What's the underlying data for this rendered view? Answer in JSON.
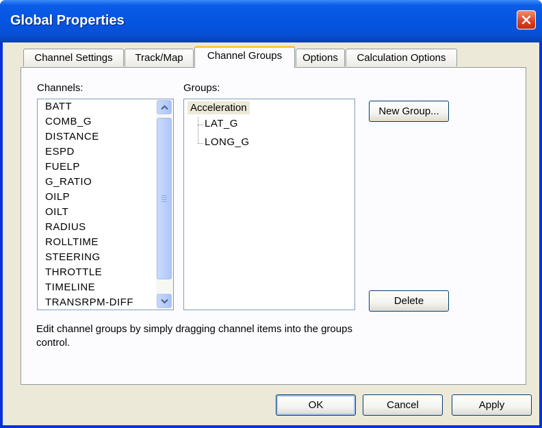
{
  "window": {
    "title": "Global Properties"
  },
  "tabs": [
    {
      "label": "Channel Settings"
    },
    {
      "label": "Track/Map"
    },
    {
      "label": "Channel Groups"
    },
    {
      "label": "Options"
    },
    {
      "label": "Calculation Options"
    }
  ],
  "panel": {
    "channels_label": "Channels:",
    "groups_label": "Groups:",
    "channels": [
      "BATT",
      "COMB_G",
      "DISTANCE",
      "ESPD",
      "FUELP",
      "G_RATIO",
      "OILP",
      "OILT",
      "RADIUS",
      "ROLLTIME",
      "STEERING",
      "THROTTLE",
      "TIMELINE",
      "TRANSRPM-DIFF"
    ],
    "groups": {
      "root": "Acceleration",
      "children": [
        "LAT_G",
        "LONG_G"
      ]
    },
    "new_group_label": "New Group...",
    "delete_label": "Delete",
    "hint": "Edit channel groups by simply dragging channel items into the groups control."
  },
  "footer": {
    "ok_label": "OK",
    "cancel_label": "Cancel",
    "apply_label": "Apply"
  },
  "colors": {
    "titlebar": "#0454e0",
    "close": "#d9452b",
    "face": "#ece9d8",
    "active_tab_accent": "#ffc83c"
  }
}
